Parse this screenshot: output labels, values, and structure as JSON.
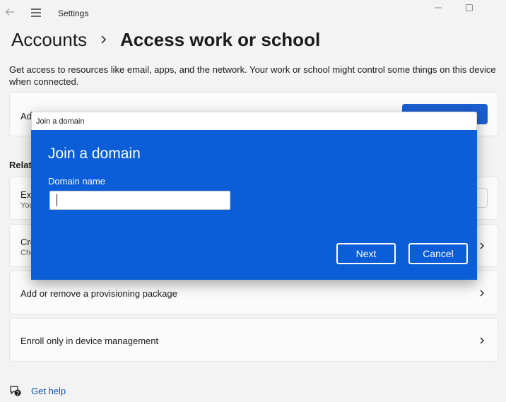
{
  "window": {
    "title": "Settings",
    "icons": {
      "back": "back-arrow-icon",
      "menu": "hamburger-icon",
      "minimize": "minimize-icon",
      "maximize": "maximize-icon"
    }
  },
  "breadcrumb": {
    "parent": "Accounts",
    "current": "Access work or school"
  },
  "description": "Get access to resources like email, apps, and the network. Your work or school might control some things on this device when connected.",
  "cards": {
    "add_account_partial": "Ad",
    "related_partial": "Relat",
    "export_partial_title": "Exp",
    "export_partial_sub": "You",
    "create_partial_title": "Cre",
    "create_partial_sub": "Cho",
    "provisioning": "Add or remove a provisioning package",
    "enroll": "Enroll only in device management"
  },
  "dialog": {
    "window_title": "Join a domain",
    "heading": "Join a domain",
    "field_label": "Domain name",
    "field_value": "",
    "next_label": "Next",
    "cancel_label": "Cancel"
  },
  "help": {
    "label": "Get help"
  },
  "colors": {
    "accent": "#0b5ed7",
    "connect_button": "#1a5fd0",
    "background": "#f3f3f3",
    "link": "#0a4fb8"
  }
}
